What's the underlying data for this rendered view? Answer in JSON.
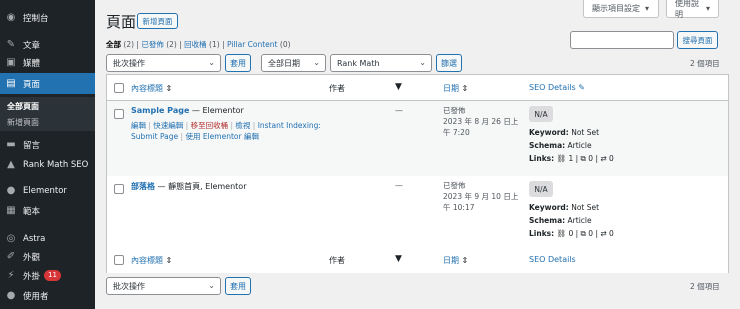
{
  "sidebar": {
    "items": [
      {
        "label": "控制台",
        "icon": "dashboard-icon"
      },
      {
        "label": "文章",
        "icon": "pin-icon"
      },
      {
        "label": "媒體",
        "icon": "media-icon"
      },
      {
        "label": "頁面",
        "icon": "page-icon"
      },
      {
        "label": "留言",
        "icon": "comment-icon"
      },
      {
        "label": "Rank Math SEO",
        "icon": "rank-math-icon"
      },
      {
        "label": "Elementor",
        "icon": "elementor-icon"
      },
      {
        "label": "範本",
        "icon": "template-icon"
      },
      {
        "label": "Astra",
        "icon": "astra-icon"
      },
      {
        "label": "外觀",
        "icon": "brush-icon"
      },
      {
        "label": "外掛",
        "icon": "plugin-icon",
        "badge": "11"
      },
      {
        "label": "使用者",
        "icon": "user-icon"
      }
    ],
    "submenu": [
      "全部頁面",
      "新增頁面"
    ]
  },
  "header": {
    "title": "頁面",
    "add_new": "新增頁面",
    "screen_options": "顯示項目設定",
    "help": "使用說明"
  },
  "filters": {
    "all": "全部",
    "all_count": "(2)",
    "published": "已發佈",
    "published_count": "(2)",
    "trash": "回收桶",
    "trash_count": "(1)",
    "pillar": "Pillar Content",
    "pillar_count": "(0)",
    "sep": "|"
  },
  "search": {
    "button": "搜尋頁面",
    "value": ""
  },
  "bulk": {
    "selected": "批次操作",
    "apply": "套用"
  },
  "date_filter": {
    "selected": "全部日期"
  },
  "rank_filter": {
    "selected": "Rank Math"
  },
  "filter_button": "篩選",
  "item_count": "2 個項目",
  "columns": {
    "title": "內容標題",
    "author": "作者",
    "date": "日期",
    "seo": "SEO Details"
  },
  "rows": [
    {
      "title": "Sample Page",
      "suffix": " — Elementor",
      "author": "—",
      "actions": {
        "edit": "編輯",
        "quick": "快速編輯",
        "trash": "移至回收桶",
        "view": "檢視",
        "instant": "Instant Indexing:",
        "submit": "Submit Page",
        "elementor": "使用 Elementor 編輯"
      },
      "date_status": "已發佈",
      "date_line1": "2023 年 8 月 26 日上",
      "date_line2": "午 7:20",
      "seo_score": "N/A",
      "keyword_label": "Keyword:",
      "keyword": "Not Set",
      "schema_label": "Schema:",
      "schema": "Article",
      "links_label": "Links:",
      "links": [
        "1",
        "0",
        "0"
      ]
    },
    {
      "title": "部落格",
      "suffix": " — 靜態首頁, Elementor",
      "author": "—",
      "date_status": "已發佈",
      "date_line1": "2023 年 9 月 10 日上",
      "date_line2": "午 10:17",
      "seo_score": "N/A",
      "keyword_label": "Keyword:",
      "keyword": "Not Set",
      "schema_label": "Schema:",
      "schema": "Article",
      "links_label": "Links:",
      "links": [
        "0",
        "0",
        "0"
      ]
    }
  ]
}
